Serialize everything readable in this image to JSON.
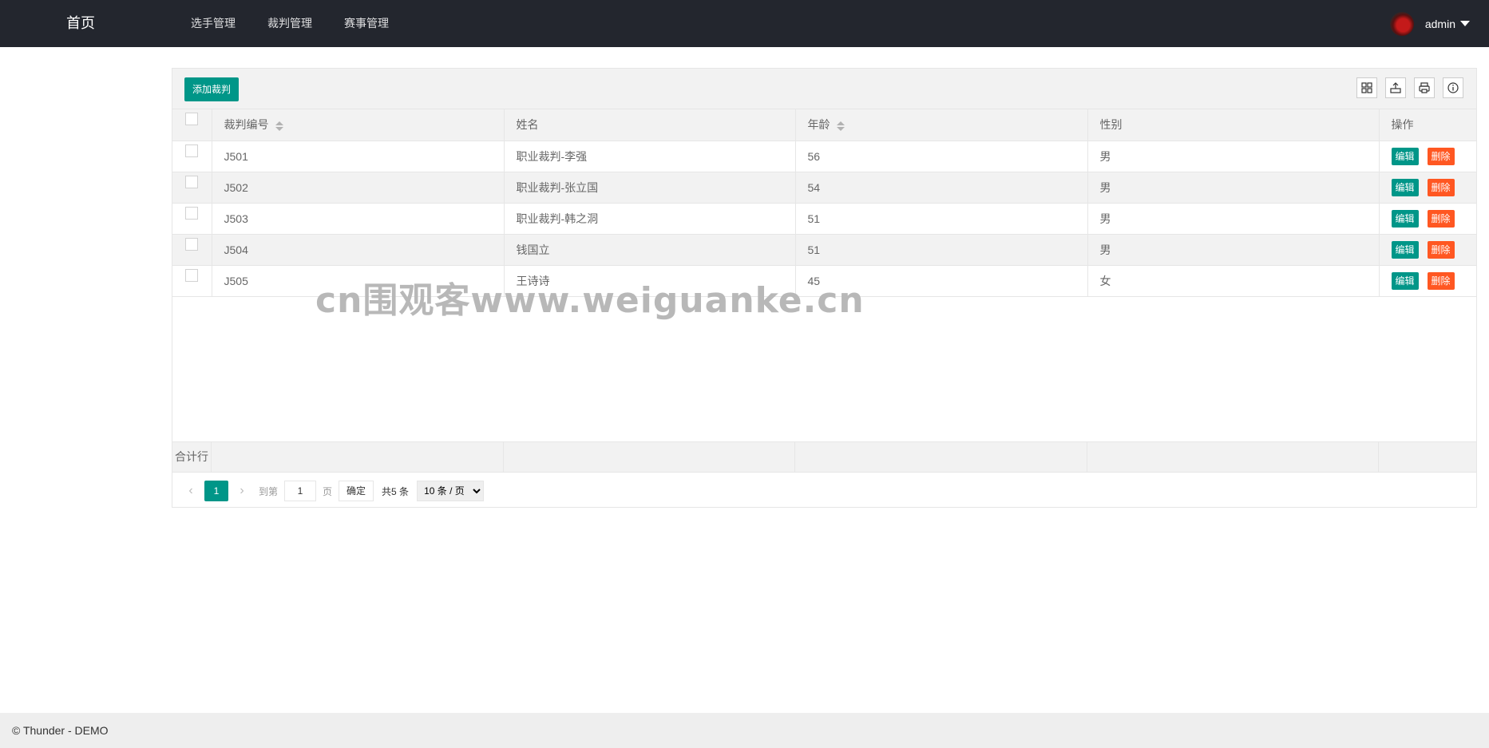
{
  "header": {
    "logo": "首页",
    "nav": [
      "选手管理",
      "裁判管理",
      "赛事管理"
    ],
    "user": "admin"
  },
  "toolbar": {
    "add_label": "添加裁判",
    "icons": [
      "grid-icon",
      "export-icon",
      "print-icon",
      "info-icon"
    ]
  },
  "table": {
    "columns": [
      "裁判编号",
      "姓名",
      "年龄",
      "性别",
      "操作"
    ],
    "rows": [
      {
        "id": "J501",
        "name": "职业裁判-李强",
        "age": "56",
        "gender": "男"
      },
      {
        "id": "J502",
        "name": "职业裁判-张立国",
        "age": "54",
        "gender": "男"
      },
      {
        "id": "J503",
        "name": "职业裁判-韩之洞",
        "age": "51",
        "gender": "男"
      },
      {
        "id": "J504",
        "name": "钱国立",
        "age": "51",
        "gender": "男"
      },
      {
        "id": "J505",
        "name": "王诗诗",
        "age": "45",
        "gender": "女"
      }
    ],
    "edit_label": "编辑",
    "delete_label": "删除",
    "total_label": "合计行"
  },
  "watermark": "cn围观客www.weiguanke.cn",
  "pager": {
    "current": "1",
    "goto_label": "到第",
    "goto_value": "1",
    "page_unit": "页",
    "ok_label": "确定",
    "count_label": "共5 条",
    "page_size": "10 条 / 页"
  },
  "footer": "© Thunder - DEMO",
  "colors": {
    "primary": "#009688",
    "danger": "#ff5722",
    "header_bg": "#23262e"
  }
}
